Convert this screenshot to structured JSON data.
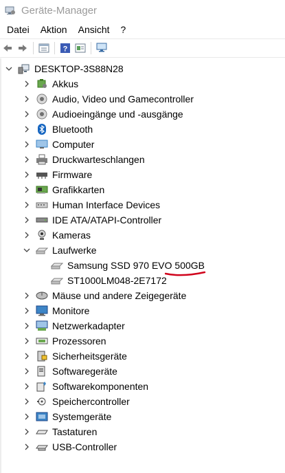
{
  "window": {
    "title": "Geräte-Manager"
  },
  "menu": [
    "Datei",
    "Aktion",
    "Ansicht",
    "?"
  ],
  "toolbar": {
    "buttons": [
      "back-icon",
      "forward-icon",
      "properties-icon",
      "help-icon",
      "update-driver-icon",
      "scan-hardware-icon"
    ]
  },
  "tree": {
    "root": "DESKTOP-3S88N28",
    "categories": [
      {
        "label": "Akkus",
        "expanded": false
      },
      {
        "label": "Audio, Video und Gamecontroller",
        "expanded": false
      },
      {
        "label": "Audioeingänge und -ausgänge",
        "expanded": false
      },
      {
        "label": "Bluetooth",
        "expanded": false
      },
      {
        "label": "Computer",
        "expanded": false
      },
      {
        "label": "Druckwarteschlangen",
        "expanded": false
      },
      {
        "label": "Firmware",
        "expanded": false
      },
      {
        "label": "Grafikkarten",
        "expanded": false
      },
      {
        "label": "Human Interface Devices",
        "expanded": false
      },
      {
        "label": "IDE ATA/ATAPI-Controller",
        "expanded": false
      },
      {
        "label": "Kameras",
        "expanded": false
      },
      {
        "label": "Laufwerke",
        "expanded": true,
        "children": [
          "Samsung SSD 970 EVO 500GB",
          "ST1000LM048-2E7172"
        ]
      },
      {
        "label": "Mäuse und andere Zeigegeräte",
        "expanded": false
      },
      {
        "label": "Monitore",
        "expanded": false
      },
      {
        "label": "Netzwerkadapter",
        "expanded": false
      },
      {
        "label": "Prozessoren",
        "expanded": false
      },
      {
        "label": "Sicherheitsgeräte",
        "expanded": false
      },
      {
        "label": "Softwaregeräte",
        "expanded": false
      },
      {
        "label": "Softwarekomponenten",
        "expanded": false
      },
      {
        "label": "Speichercontroller",
        "expanded": false
      },
      {
        "label": "Systemgeräte",
        "expanded": false
      },
      {
        "label": "Tastaturen",
        "expanded": false
      },
      {
        "label": "USB-Controller",
        "expanded": false
      }
    ]
  },
  "annotation": {
    "color": "#d0021b"
  }
}
